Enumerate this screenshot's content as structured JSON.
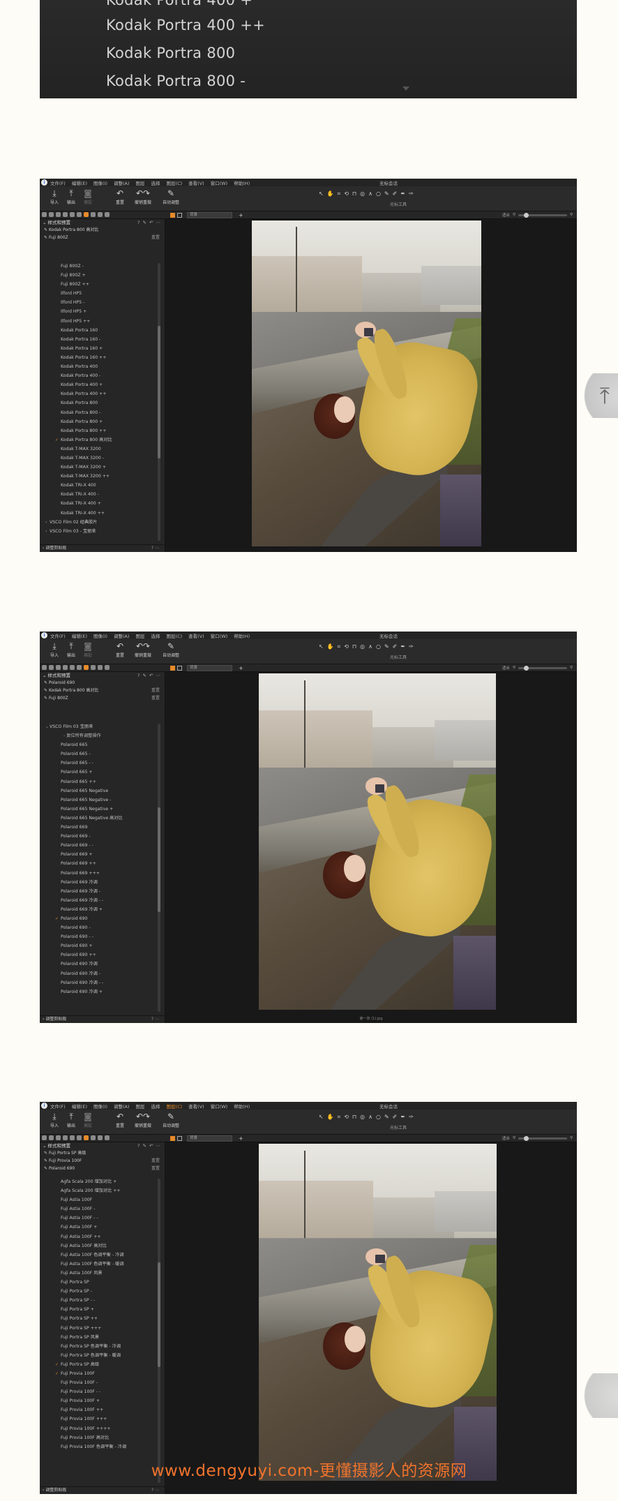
{
  "top_list": {
    "items": [
      "Kodak Portra 400 +",
      "Kodak Portra 400 ++",
      "Kodak Portra 800",
      "Kodak Portra 800 -"
    ]
  },
  "app": {
    "window_title": "无标会话",
    "menu": [
      "文件(F)",
      "编辑(E)",
      "图像(I)",
      "调整(A)",
      "图层",
      "选择",
      "图层(C)",
      "查看(V)",
      "窗口(W)",
      "帮助(H)"
    ],
    "menu_alt": [
      "文件(F)",
      "编辑(E)",
      "图像(I)",
      "调整(A)",
      "图层",
      "选择",
      "图层(C)",
      "查看(V)",
      "窗口(W)",
      "帮助(H)"
    ],
    "toolbar": {
      "import": "导入",
      "export": "输出",
      "capture": "捕捉",
      "reset": "重置",
      "undo_redo": "撤销重做",
      "auto": "自动调整",
      "cursor_label": "光标工具"
    },
    "view_select": "背景",
    "zoom_label": "适合",
    "panel_title": "样式和预置",
    "bottom_panel": "调整剪贴板",
    "reset_label": "重置"
  },
  "window1": {
    "applied": [
      "Kodak Portra 800 高对比",
      "Fuji 800Z"
    ],
    "items": [
      {
        "t": "Fuji 800Z -"
      },
      {
        "t": "Fuji 800Z +"
      },
      {
        "t": "Fuji 800Z ++"
      },
      {
        "t": "Ilford HP5"
      },
      {
        "t": "Ilford HP5 -"
      },
      {
        "t": "Ilford HP5 +"
      },
      {
        "t": "Ilford HP5 ++"
      },
      {
        "t": "Kodak Portra 160"
      },
      {
        "t": "Kodak Portra 160 -"
      },
      {
        "t": "Kodak Portra 160 +"
      },
      {
        "t": "Kodak Portra 160 ++"
      },
      {
        "t": "Kodak Portra 400"
      },
      {
        "t": "Kodak Portra 400 -"
      },
      {
        "t": "Kodak Portra 400 +"
      },
      {
        "t": "Kodak Portra 400 ++"
      },
      {
        "t": "Kodak Portra 800"
      },
      {
        "t": "Kodak Portra 800 -"
      },
      {
        "t": "Kodak Portra 800 +"
      },
      {
        "t": "Kodak Portra 800 ++"
      },
      {
        "t": "Kodak Portra 800 高对比",
        "c": true
      },
      {
        "t": "Kodak T-MAX 3200"
      },
      {
        "t": "Kodak T-MAX 3200 -"
      },
      {
        "t": "Kodak T-MAX 3200 +"
      },
      {
        "t": "Kodak T-MAX 3200 ++"
      },
      {
        "t": "Kodak TRI-X 400"
      },
      {
        "t": "Kodak TRI-X 400 -"
      },
      {
        "t": "Kodak TRI-X 400 +"
      },
      {
        "t": "Kodak TRI-X 400 ++"
      },
      {
        "t": "VSCO Film 02 经典胶片",
        "f": true
      },
      {
        "t": "VSCO Film 03 - 宝丽来",
        "f": true
      }
    ]
  },
  "window2": {
    "applied": [
      "Polaroid 690",
      "Kodak Portra 800 高对比",
      "Fuji 800Z"
    ],
    "items": [
      {
        "t": "VSCO Film 03 宝丽来",
        "f": true,
        "o": true
      },
      {
        "t": "- 复位所有调整操作",
        "tip": true
      },
      {
        "t": "Polaroid 665"
      },
      {
        "t": "Polaroid 665 -"
      },
      {
        "t": "Polaroid 665 - -"
      },
      {
        "t": "Polaroid 665 +"
      },
      {
        "t": "Polaroid 665 ++"
      },
      {
        "t": "Polaroid 665 Negative"
      },
      {
        "t": "Polaroid 665 Negative -"
      },
      {
        "t": "Polaroid 665 Negative +"
      },
      {
        "t": "Polaroid 665 Negative 高对比"
      },
      {
        "t": "Polaroid 669"
      },
      {
        "t": "Polaroid 669 -"
      },
      {
        "t": "Polaroid 669 - -"
      },
      {
        "t": "Polaroid 669 +"
      },
      {
        "t": "Polaroid 669 ++"
      },
      {
        "t": "Polaroid 669 +++"
      },
      {
        "t": "Polaroid 669 冷调"
      },
      {
        "t": "Polaroid 669 冷调 -"
      },
      {
        "t": "Polaroid 669 冷调 - -"
      },
      {
        "t": "Polaroid 669 冷调 +"
      },
      {
        "t": "Polaroid 690",
        "c": true
      },
      {
        "t": "Polaroid 690 -"
      },
      {
        "t": "Polaroid 690 - -"
      },
      {
        "t": "Polaroid 690 +"
      },
      {
        "t": "Polaroid 690 ++"
      },
      {
        "t": "Polaroid 690 冷调"
      },
      {
        "t": "Polaroid 690 冷调 -"
      },
      {
        "t": "Polaroid 690 冷调 - -"
      },
      {
        "t": "Polaroid 690 冷调 +"
      }
    ],
    "filename": "第一张 (1).jpg"
  },
  "window3": {
    "applied": [
      "Fuji Portra SP 高级",
      "Fuji Provia 100F",
      "Polaroid 690"
    ],
    "items": [
      {
        "t": "Agfa Scala 200 增加对比 +"
      },
      {
        "t": "Agfa Scala 200 增加对比 ++"
      },
      {
        "t": "Fuji Astia 100F"
      },
      {
        "t": "Fuji Astia 100F -"
      },
      {
        "t": "Fuji Astia 100F - -"
      },
      {
        "t": "Fuji Astia 100F +"
      },
      {
        "t": "Fuji Astia 100F ++"
      },
      {
        "t": "Fuji Astia 100F 高对比"
      },
      {
        "t": "Fuji Astia 100F 色调平衡 - 冷调"
      },
      {
        "t": "Fuji Astia 100F 色调平衡 - 暖调"
      },
      {
        "t": "Fuji Astia 100F 风景"
      },
      {
        "t": "Fuji Portra SP"
      },
      {
        "t": "Fuji Portra SP -"
      },
      {
        "t": "Fuji Portra SP - -"
      },
      {
        "t": "Fuji Portra SP +"
      },
      {
        "t": "Fuji Portra SP ++"
      },
      {
        "t": "Fuji Portra SP +++"
      },
      {
        "t": "Fuji Portra SP 风景"
      },
      {
        "t": "Fuji Portra SP 色调平衡 - 冷调"
      },
      {
        "t": "Fuji Portra SP 色调平衡 - 暖调"
      },
      {
        "t": "Fuji Portra SP 高级",
        "c": true
      },
      {
        "t": "Fuji Provia 100F",
        "c": true
      },
      {
        "t": "Fuji Provia 100F -"
      },
      {
        "t": "Fuji Provia 100F - -"
      },
      {
        "t": "Fuji Provia 100F +"
      },
      {
        "t": "Fuji Provia 100F ++"
      },
      {
        "t": "Fuji Provia 100F +++"
      },
      {
        "t": "Fuji Provia 100F ++++"
      },
      {
        "t": "Fuji Provia 100F 高对比"
      },
      {
        "t": "Fuji Provia 100F 色调平衡 - 冷调"
      }
    ]
  },
  "watermark": "www.dengyuyi.com-更懂摄影人的资源网"
}
